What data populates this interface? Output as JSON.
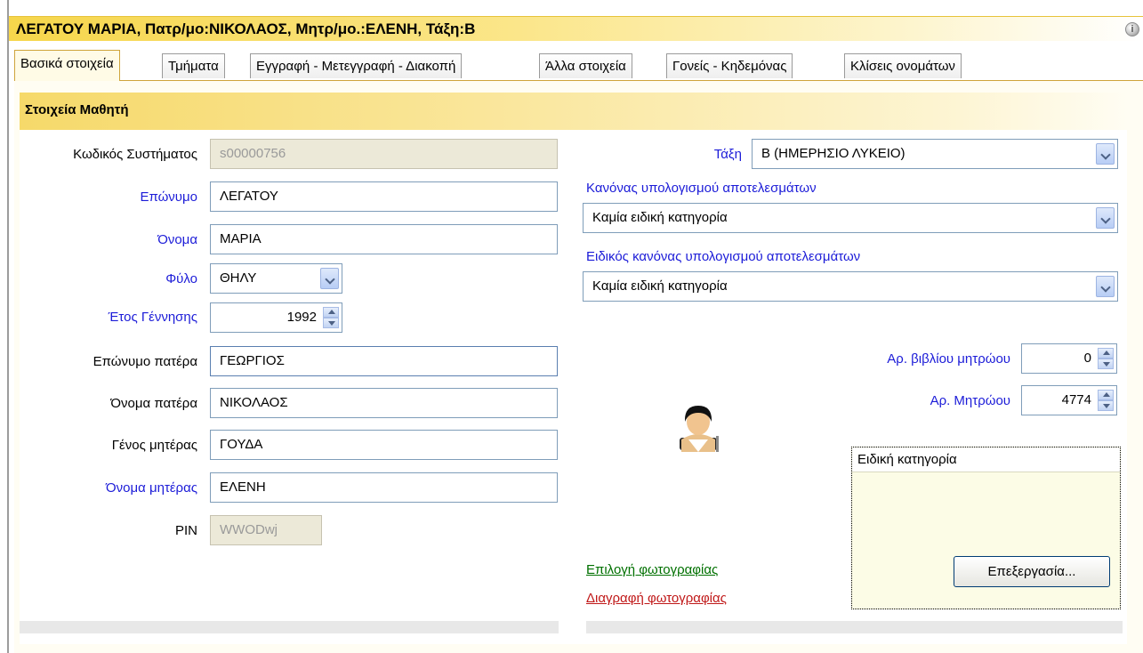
{
  "window": {
    "title": "ΛΕΓΑΤΟΥ ΜΑΡΙΑ, Πατρ/μο:ΝΙΚΟΛΑΟΣ, Μητρ/μο.:ΕΛΕΝΗ, Τάξη:Β",
    "info_icon_glyph": "i"
  },
  "tabs": [
    {
      "label": "Βασικά στοιχεία",
      "active": true
    },
    {
      "label": "Τμήματα",
      "active": false
    },
    {
      "label": "Εγγραφή - Μετεγγραφή - Διακοπή",
      "active": false
    },
    {
      "label": "Άλλα στοιχεία",
      "active": false
    },
    {
      "label": "Γονείς - Κηδεμόνας",
      "active": false
    },
    {
      "label": "Κλίσεις ονομάτων",
      "active": false
    }
  ],
  "section": {
    "title": "Στοιχεία Μαθητή"
  },
  "form": {
    "system_code": {
      "label": "Κωδικός Συστήματος",
      "value": "s00000756"
    },
    "surname": {
      "label": "Επώνυμο",
      "value": "ΛΕΓΑΤΟΥ"
    },
    "name": {
      "label": "Όνομα",
      "value": "ΜΑΡΙΑ"
    },
    "gender": {
      "label": "Φύλο",
      "value": "ΘΗΛΥ"
    },
    "birth_year": {
      "label": "Έτος Γέννησης",
      "value": "1992"
    },
    "father_surname": {
      "label": "Επώνυμο πατέρα",
      "value": "ΓΕΩΡΓΙΟΣ"
    },
    "father_name": {
      "label": "Όνομα πατέρα",
      "value": "ΝΙΚΟΛΑΟΣ"
    },
    "mother_surname": {
      "label": "Γένος μητέρας",
      "value": "ΓΟΥΔΑ"
    },
    "mother_name": {
      "label": "Όνομα μητέρας",
      "value": "ΕΛΕΝΗ"
    },
    "pin": {
      "label": "PIN",
      "value": "WWODwj"
    }
  },
  "right": {
    "class": {
      "label": "Τάξη",
      "value": "Β  (ΗΜΕΡΗΣΙΟ ΛΥΚΕΙΟ)"
    },
    "results_rule": {
      "label": "Κανόνας υπολογισμού αποτελεσμάτων",
      "value": "Καμία ειδική κατηγορία"
    },
    "special_rule": {
      "label": "Ειδικός κανόνας υπολογισμού αποτελεσμάτων",
      "value": "Καμία ειδική κατηγορία"
    },
    "registry_book_no": {
      "label": "Αρ. βιβλίου μητρώου",
      "value": "0"
    },
    "registry_no": {
      "label": "Αρ. Μητρώου",
      "value": "4774"
    }
  },
  "photo": {
    "select_link": "Επιλογή φωτογραφίας",
    "delete_link": "Διαγραφή φωτογραφίας"
  },
  "special_category": {
    "title": "Ειδική κατηγορία",
    "edit_button": "Επεξεργασία..."
  },
  "colors": {
    "title_bar": "#f6d64b",
    "label_blue": "#1c1cd8",
    "link_green": "#007000",
    "link_red": "#c01818",
    "tab_active_border": "#cfa43b"
  }
}
